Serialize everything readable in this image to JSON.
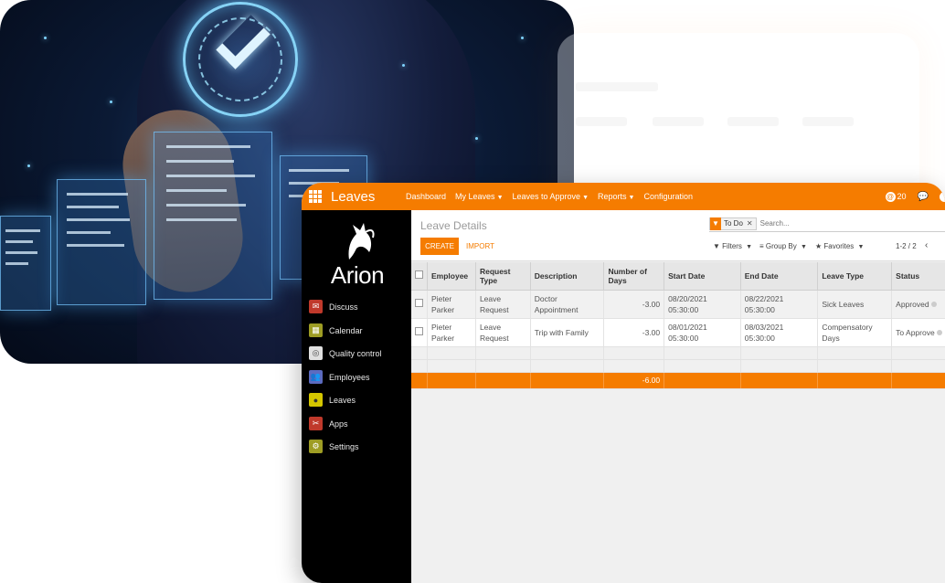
{
  "app": {
    "title": "Leaves",
    "nav": [
      {
        "label": "Dashboard",
        "caret": false
      },
      {
        "label": "My Leaves",
        "caret": true
      },
      {
        "label": "Leaves to Approve",
        "caret": true
      },
      {
        "label": "Reports",
        "caret": true
      },
      {
        "label": "Configuration",
        "caret": false
      }
    ],
    "notifications": "20"
  },
  "brand": {
    "name": "Arion"
  },
  "sidebar": {
    "items": [
      {
        "label": "Discuss",
        "icon": "chat-icon",
        "color": "#c0392b"
      },
      {
        "label": "Calendar",
        "icon": "calendar-icon",
        "color": "#9e9d24"
      },
      {
        "label": "Quality control",
        "icon": "quality-icon",
        "color": "#e0e0e0"
      },
      {
        "label": "Employees",
        "icon": "employees-icon",
        "color": "#5c6bc0"
      },
      {
        "label": "Leaves",
        "icon": "leaves-icon",
        "color": "#d4c600"
      },
      {
        "label": "Apps",
        "icon": "apps-icon",
        "color": "#c0392b"
      },
      {
        "label": "Settings",
        "icon": "gear-icon",
        "color": "#9e9d24"
      }
    ]
  },
  "control": {
    "breadcrumb": "Leave Details",
    "facet": "To Do",
    "search_placeholder": "Search...",
    "create_label": "CREATE",
    "import_label": "IMPORT",
    "filters_label": "Filters",
    "groupby_label": "Group By",
    "favorites_label": "Favorites",
    "pager": "1-2 / 2"
  },
  "table": {
    "headers": [
      "Employee",
      "Request Type",
      "Description",
      "Number of Days",
      "Start Date",
      "End Date",
      "Leave Type",
      "Status"
    ],
    "rows": [
      {
        "employee": "Pieter Parker",
        "request_type": "Leave Request",
        "description": "Doctor Appointment",
        "days": "-3.00",
        "start": "08/20/2021 05:30:00",
        "end": "08/22/2021 05:30:00",
        "leave_type": "Sick Leaves",
        "status": "Approved"
      },
      {
        "employee": "Pieter Parker",
        "request_type": "Leave Request",
        "description": "Trip with Family",
        "days": "-3.00",
        "start": "08/01/2021 05:30:00",
        "end": "08/03/2021 05:30:00",
        "leave_type": "Compensatory Days",
        "status": "To Approve"
      }
    ],
    "total_days": "-6.00"
  },
  "colors": {
    "accent": "#f57c00",
    "sidebar": "#000000"
  }
}
